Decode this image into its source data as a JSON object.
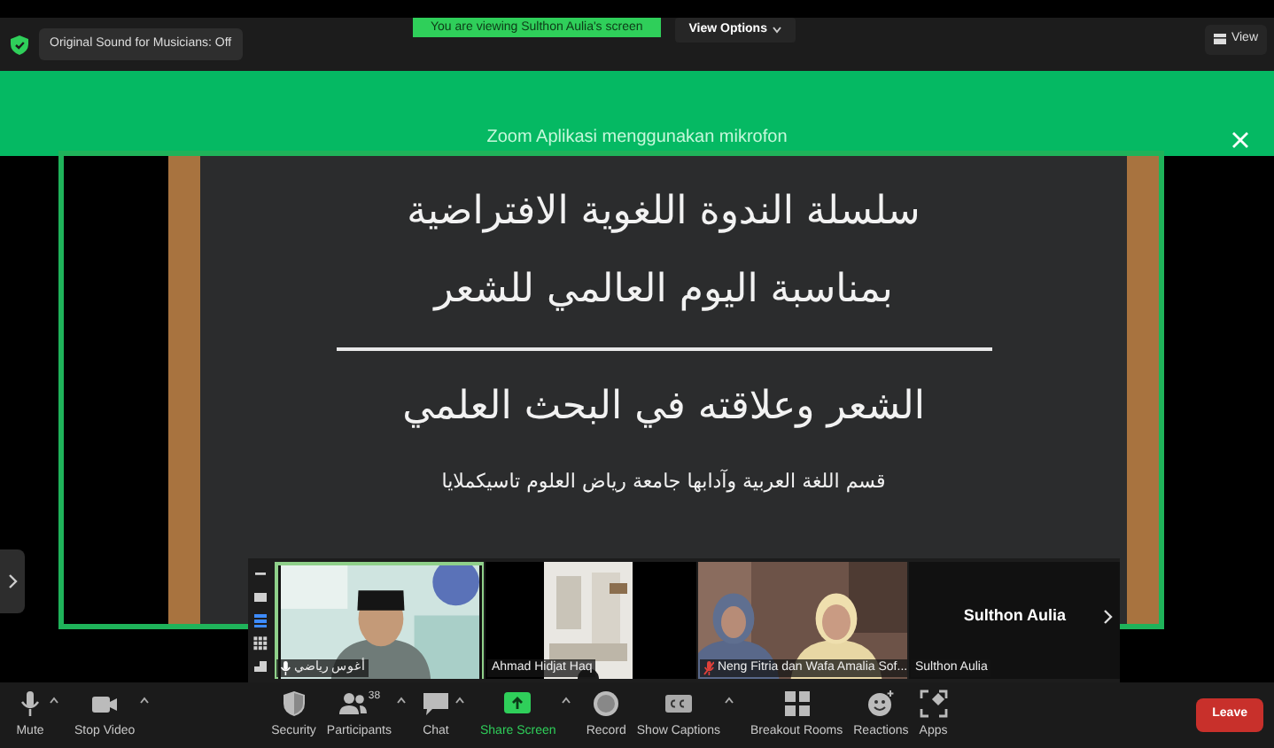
{
  "top_bar": {
    "original_sound": "Original Sound for Musicians: Off",
    "viewing_banner": "You are viewing Sulthon Aulia's screen",
    "view_options": "View Options",
    "view": "View"
  },
  "notification": {
    "text": "Zoom Aplikasi menggunakan mikrofon"
  },
  "shared_screen": {
    "title_lines": [
      "سلسلة الندوة اللغوية الافتراضية",
      "بمناسبة اليوم العالمي للشعر"
    ],
    "subtitle": "الشعر وعلاقته في البحث العلمي",
    "institution": "قسم اللغة العربية وآدابها جامعة رياض العلوم تاسيكملايا"
  },
  "gallery": {
    "view_buttons": [
      {
        "kind": "minimize",
        "selected": false
      },
      {
        "kind": "speaker",
        "selected": false
      },
      {
        "kind": "strip",
        "selected": true
      },
      {
        "kind": "grid",
        "selected": false
      },
      {
        "kind": "layout",
        "selected": false
      }
    ],
    "tiles": [
      {
        "kind": "video",
        "name": "أغوس رياضي",
        "mic_muted": false,
        "speaking": true
      },
      {
        "kind": "video",
        "name": "Ahmad Hidjat Haq",
        "speaking": false
      },
      {
        "kind": "video",
        "name": "Neng Fitria dan Wafa Amalia Sof...",
        "mic_muted": true,
        "speaking": false
      },
      {
        "kind": "name_only",
        "display": "Sulthon Aulia",
        "name": "Sulthon Aulia",
        "speaking": false
      }
    ]
  },
  "toolbar": {
    "items": [
      {
        "kind": "mic",
        "label": "Mute",
        "caret": true
      },
      {
        "kind": "camera",
        "label": "Stop Video",
        "caret": true
      },
      {
        "kind": "shield",
        "label": "Security",
        "caret": false
      },
      {
        "kind": "people",
        "label": "Participants",
        "badge": "38",
        "caret": true
      },
      {
        "kind": "chat",
        "label": "Chat",
        "caret": true
      },
      {
        "kind": "share",
        "label": "Share Screen",
        "caret": true
      },
      {
        "kind": "record",
        "label": "Record",
        "caret": false
      },
      {
        "kind": "captions",
        "label": "Show Captions",
        "caret": true
      },
      {
        "kind": "rooms",
        "label": "Breakout Rooms",
        "caret": false
      },
      {
        "kind": "reactions",
        "label": "Reactions",
        "caret": false
      },
      {
        "kind": "apps",
        "label": "Apps",
        "caret": false
      }
    ],
    "leave": "Leave"
  }
}
